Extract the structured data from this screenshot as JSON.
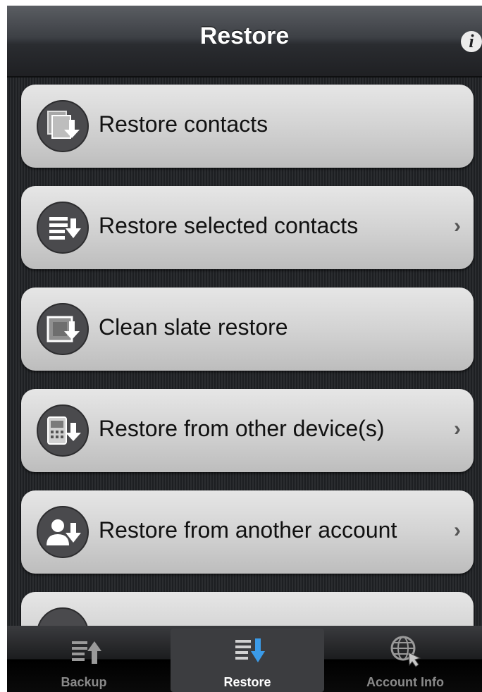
{
  "navbar": {
    "title": "Restore",
    "info_icon": "info-icon"
  },
  "rows": [
    {
      "label": "Restore contacts",
      "icon": "restore-contacts-icon",
      "has_chevron": false
    },
    {
      "label": "Restore selected contacts",
      "icon": "restore-list-icon",
      "has_chevron": true
    },
    {
      "label": "Clean slate restore",
      "icon": "clean-slate-icon",
      "has_chevron": false
    },
    {
      "label": "Restore from other device(s)",
      "icon": "device-restore-icon",
      "has_chevron": true
    },
    {
      "label": "Restore from another account",
      "icon": "account-restore-icon",
      "has_chevron": true
    }
  ],
  "chevron_glyph": "›",
  "tabs": [
    {
      "label": "Backup",
      "icon": "backup-icon",
      "active": false
    },
    {
      "label": "Restore",
      "icon": "restore-icon",
      "active": true
    },
    {
      "label": "Account Info",
      "icon": "globe-cursor-icon",
      "active": false
    }
  ],
  "colors": {
    "accent_blue": "#3b9be8",
    "row_bg": "#d3d3d3"
  }
}
